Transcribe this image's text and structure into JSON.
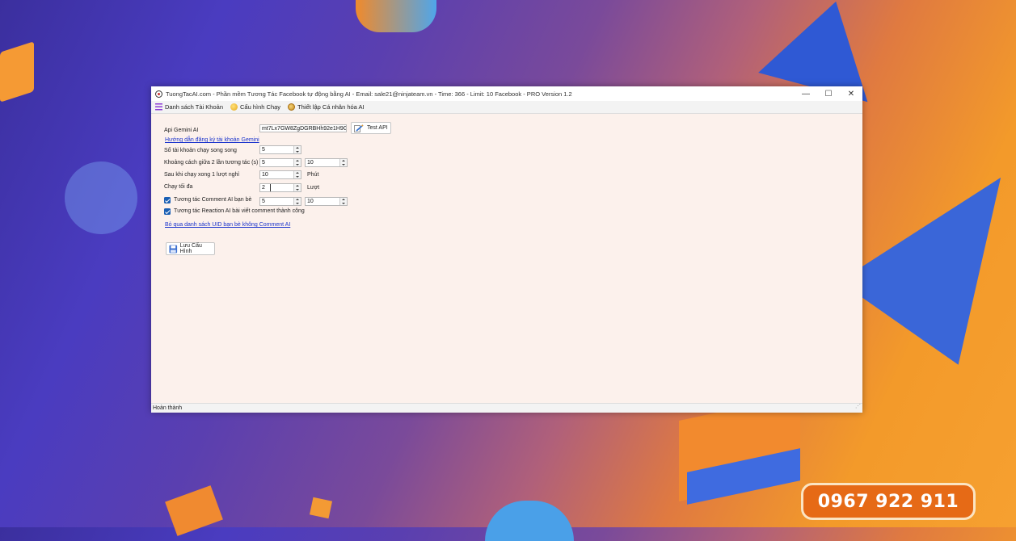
{
  "window": {
    "title": "TuongTacAI.com - Phần mềm Tương Tác Facebook tự động bằng AI - Email: sale21@ninjateam.vn - Time: 366 - Limit: 10 Facebook - PRO Version 1.2",
    "controls": {
      "minimize": "—",
      "maximize": "☐",
      "close": "✕"
    }
  },
  "menu": [
    {
      "label": "Danh sách Tài Khoản",
      "icon": "hamburger-icon"
    },
    {
      "label": "Cấu hình Chạy",
      "icon": "lightbulb-icon"
    },
    {
      "label": "Thiết lập Cá nhân hóa AI",
      "icon": "coin-icon"
    }
  ],
  "config": {
    "api_label": "Api Gemini AI",
    "api_value": "mt7Lx7GW8ZgDGRBHh92e1H9GU",
    "test_api_label": "Test API",
    "guide_link": "Hướng dẫn đăng ký tài khoản Gemini",
    "parallel_label": "Số tài khoản chạy song song",
    "parallel_value": "5",
    "interval_label": "Khoảng cách giữa 2 lần tương tác (s)",
    "interval_min": "5",
    "interval_max": "10",
    "rest_label": "Sau khi chạy xong 1 lượt nghỉ",
    "rest_value": "10",
    "rest_unit": "Phút",
    "max_runs_label": "Chạy tối đa",
    "max_runs_value": "2",
    "max_runs_unit": "Lượt",
    "comment_label": "Tương tác Comment AI bạn bè",
    "comment_checked": true,
    "comment_min": "5",
    "comment_max": "10",
    "reaction_label": "Tương tác Reaction AI bài viết comment thành công",
    "reaction_checked": true,
    "skip_link": "Bỏ qua danh sách UID bạn bè không Comment AI",
    "save_label": "Lưu Cấu Hình"
  },
  "status": "Hoàn thành",
  "overlay": {
    "phone": "0967 922 911"
  }
}
